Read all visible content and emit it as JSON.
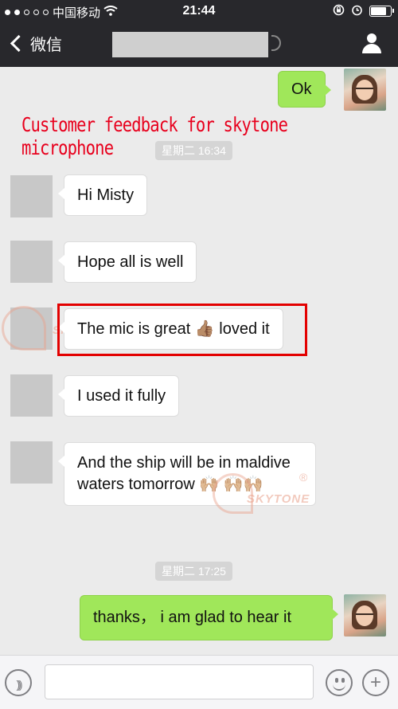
{
  "status_bar": {
    "carrier": "中国移动",
    "time": "21:44",
    "signal_dots_filled": 2,
    "signal_dots_total": 5,
    "battery_level": 0.85
  },
  "nav": {
    "back_label": "微信"
  },
  "overlay_caption": "Customer feedback for skytone microphone",
  "watermark": {
    "text": "SKYTONE",
    "registered_mark": "®"
  },
  "messages": [
    {
      "side": "out",
      "text": "Ok"
    },
    {
      "type": "time",
      "text": "星期二 16:34"
    },
    {
      "side": "in",
      "text": "Hi Misty"
    },
    {
      "side": "in",
      "text": "Hope all is well"
    },
    {
      "side": "in",
      "text": "The mic is great 👍🏽 loved it",
      "highlighted": true
    },
    {
      "side": "in",
      "text": "I used it fully"
    },
    {
      "side": "in",
      "text": "And the ship will be in maldive waters tomorrow 🙌🏼 🙌🏼🙌🏼"
    },
    {
      "type": "time",
      "text": "星期二 17:25"
    },
    {
      "side": "out",
      "text": "thanks， i am glad to hear it"
    }
  ],
  "input_bar": {
    "voice_icon": "voice-icon",
    "emoji_icon": "emoji-icon",
    "plus_icon": "plus-icon",
    "plus_glyph": "+"
  },
  "colors": {
    "nav_bg": "#28282c",
    "chat_bg": "#ebebeb",
    "outgoing_bubble": "#a0e75a",
    "caption_red": "#e8001d",
    "highlight_red": "#e30000"
  }
}
